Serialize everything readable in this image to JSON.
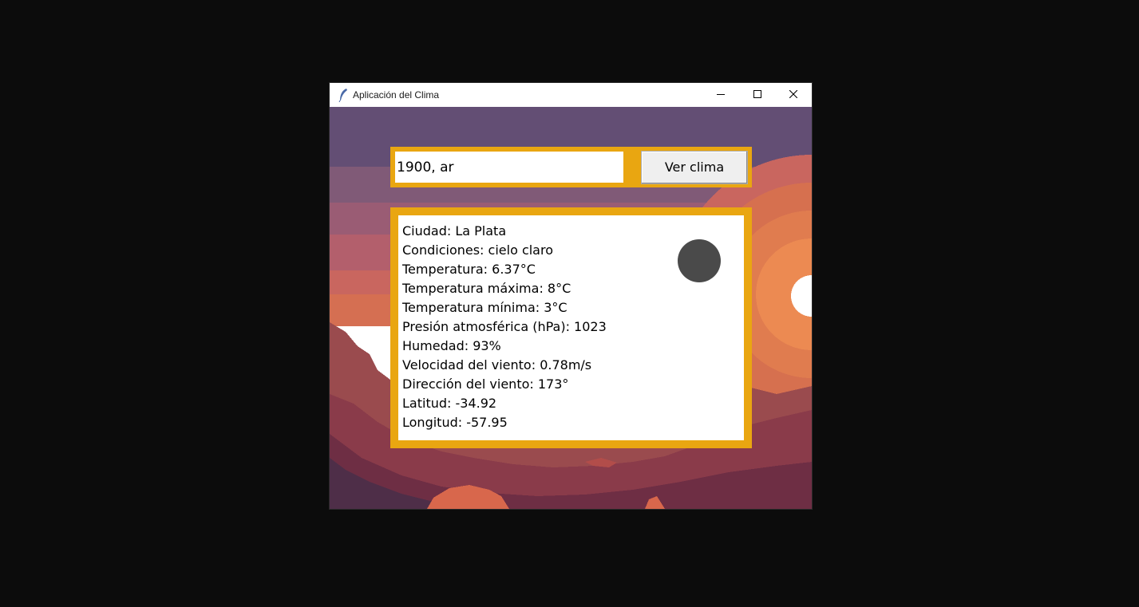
{
  "window": {
    "title": "Aplicación del Clima"
  },
  "search": {
    "value": "1900, ar",
    "button_label": "Ver clima"
  },
  "weather": {
    "lines": [
      "Ciudad: La Plata",
      "Condiciones: cielo claro",
      "Temperatura: 6.37°C",
      "Temperatura máxima: 8°C",
      "Temperatura mínima: 3°C",
      "Presión atmosférica (hPa): 1023",
      "Humedad: 93%",
      "Velocidad del viento: 0.78m/s",
      "Dirección del viento: 173°",
      "Latitud: -34.92",
      "Longitud: -57.95"
    ],
    "icon": "clear-sky-icon"
  },
  "colors": {
    "frame_accent": "#e9a611",
    "sky_top": "#634e74",
    "sun": "#ffffff",
    "mountains": "#8a3b4a"
  }
}
